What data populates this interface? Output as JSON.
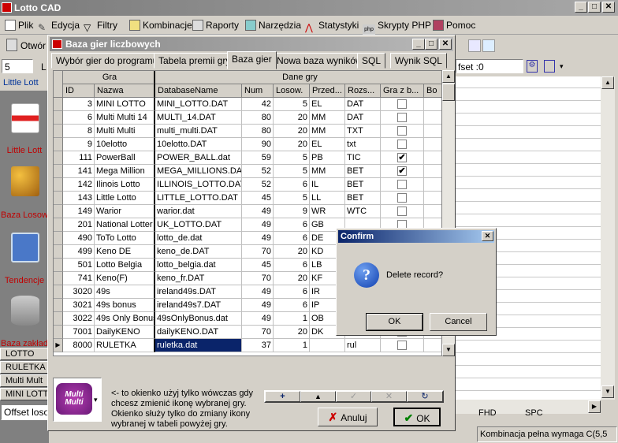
{
  "app": {
    "title": "Lotto CAD"
  },
  "menu": [
    {
      "label": "Plik",
      "icon": "file-icon"
    },
    {
      "label": "Edycja",
      "icon": "pencil-icon"
    },
    {
      "label": "Filtry",
      "icon": "filter-icon"
    },
    {
      "label": "Kombinacje",
      "icon": "dice-icon"
    },
    {
      "label": "Raporty",
      "icon": "printer-icon"
    },
    {
      "label": "Narzędzia",
      "icon": "tools-icon"
    },
    {
      "label": "Statystyki",
      "icon": "chart-icon"
    },
    {
      "label": "Skrypty PHP",
      "icon": "php-icon"
    },
    {
      "label": "Pomoc",
      "icon": "help-book-icon"
    }
  ],
  "toolbar": {
    "open_label": "Otwór",
    "count_value": "5",
    "l_label": "L",
    "offset_label": "fset :0"
  },
  "left_panel": {
    "top_label": "Little Lott",
    "item1_label": "Little Lott",
    "item2_label": "Baza Losow",
    "item3_label": "Tendencje",
    "item4_label": "Baza zakład",
    "list": [
      "LOTTO",
      "RULETKA",
      "Multi Mult",
      "MINI LOTT"
    ],
    "offset_field": "Offset loso"
  },
  "dialog": {
    "title": "Baza gier liczbowych",
    "tabs": [
      "Wybór gier do programu",
      "Tabela premii gry",
      "Baza gier",
      "Nowa baza wyników",
      "SQL",
      "Wynik SQL"
    ],
    "selected_tab": "Baza gier",
    "group_headers": {
      "gra": "Gra",
      "dane": "Dane gry"
    },
    "columns": [
      "ID",
      "Nazwa",
      "DatabaseName",
      "Num",
      "Losow.",
      "Przed...",
      "Rozs...",
      "Gra z b...",
      "Bo"
    ],
    "rows": [
      [
        "3",
        "MINI LOTTO",
        "MINI_LOTTO.DAT",
        "42",
        "5",
        "EL",
        "DAT",
        ""
      ],
      [
        "6",
        "Multi Multi 14",
        "MULTI_14.DAT",
        "80",
        "20",
        "MM",
        "DAT",
        ""
      ],
      [
        "8",
        "Multi Multi",
        "multi_multi.DAT",
        "80",
        "20",
        "MM",
        "TXT",
        ""
      ],
      [
        "9",
        "10elotto",
        "10elotto.DAT",
        "90",
        "20",
        "EL",
        "txt",
        ""
      ],
      [
        "111",
        "PowerBall",
        "POWER_BALL.dat",
        "59",
        "5",
        "PB",
        "TIC",
        "✔"
      ],
      [
        "141",
        "Mega Million",
        "MEGA_MILLIONS.DAT",
        "52",
        "5",
        "MM",
        "BET",
        "✔"
      ],
      [
        "142",
        "Ilinois Lotto",
        "ILLINOIS_LOTTO.DAT",
        "52",
        "6",
        "IL",
        "BET",
        ""
      ],
      [
        "143",
        "Little Lotto",
        "LITTLE_LOTTO.DAT",
        "45",
        "5",
        "LL",
        "BET",
        ""
      ],
      [
        "149",
        "Warior",
        "warior.dat",
        "49",
        "9",
        "WR",
        "WTC",
        ""
      ],
      [
        "201",
        "National Lotter",
        "UK_LOTTO.DAT",
        "49",
        "6",
        "GB",
        "",
        ""
      ],
      [
        "490",
        "ToTo Lotto",
        "lotto_de.dat",
        "49",
        "6",
        "DE",
        "",
        ""
      ],
      [
        "499",
        "Keno DE",
        "keno_de.DAT",
        "70",
        "20",
        "KD",
        "",
        ""
      ],
      [
        "501",
        "Lotto Belgia",
        "lotto_belgia.dat",
        "45",
        "6",
        "LB",
        "",
        ""
      ],
      [
        "741",
        "Keno(F)",
        "keno_fr.DAT",
        "70",
        "20",
        "KF",
        "",
        ""
      ],
      [
        "3020",
        "49s",
        "ireland49s.DAT",
        "49",
        "6",
        "IR",
        "",
        ""
      ],
      [
        "3021",
        "49s bonus",
        "ireland49s7.DAT",
        "49",
        "6",
        "IP",
        "",
        ""
      ],
      [
        "3022",
        "49s Only Bonus",
        "49sOnlyBonus.dat",
        "49",
        "1",
        "OB",
        "",
        ""
      ],
      [
        "7001",
        "DailyKENO",
        "dailyKENO.DAT",
        "70",
        "20",
        "DK",
        "",
        ""
      ],
      [
        "8000",
        "RULETKA",
        "ruletka.dat",
        "37",
        "1",
        "",
        "rul",
        ""
      ]
    ],
    "icon_logo": "Multi Multi",
    "hint": "<- to okienko użyj tylko wówczas gdy chcesz zmienić ikonę wybranej gry. Okienko służy tylko do zmiany ikony wybranej w tabeli powyżej gry.",
    "nav_buttons": [
      "+",
      "▲",
      "✓",
      "✕",
      "↻"
    ],
    "cancel_label": "Anuluj",
    "ok_label": "OK"
  },
  "confirm": {
    "title": "Confirm",
    "message": "Delete record?",
    "ok_label": "OK",
    "cancel_label": "Cancel"
  },
  "status": {
    "fhd": "FHD",
    "spc": "SPC",
    "message": "Kombinacja pełna wymaga C(5,5"
  },
  "colors": {
    "selected_cell": "#0a246a",
    "confirm_title": "#0a246a",
    "ok_icon": "#008000",
    "cancel_icon": "#cc0000"
  }
}
